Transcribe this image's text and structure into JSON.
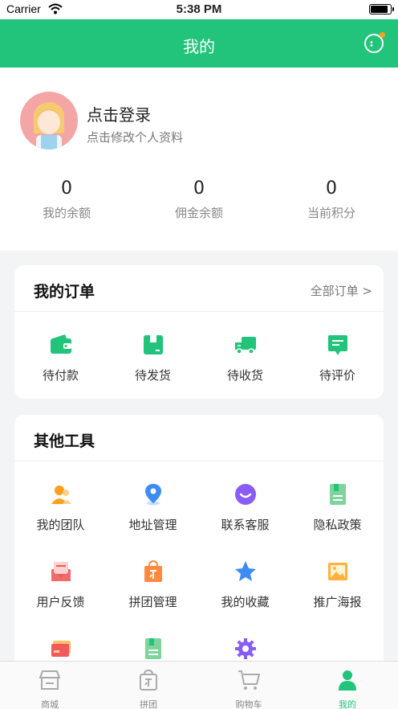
{
  "status_bar": {
    "carrier": "Carrier",
    "time": "5:38 PM",
    "battery_level": 0.9
  },
  "nav": {
    "title": "我的",
    "message_icon": "chat-icon"
  },
  "profile": {
    "login_text": "点击登录",
    "edit_text": "点击修改个人资料",
    "stats": [
      {
        "value": "0",
        "label": "我的余额"
      },
      {
        "value": "0",
        "label": "佣金余额"
      },
      {
        "value": "0",
        "label": "当前积分"
      }
    ]
  },
  "orders": {
    "title": "我的订单",
    "all_link": "全部订单 >",
    "items": [
      {
        "label": "待付款",
        "icon": "wallet-icon"
      },
      {
        "label": "待发货",
        "icon": "box-icon"
      },
      {
        "label": "待收货",
        "icon": "truck-icon"
      },
      {
        "label": "待评价",
        "icon": "comment-icon"
      }
    ]
  },
  "tools": {
    "title": "其他工具",
    "items": [
      {
        "label": "我的团队",
        "icon": "team-icon"
      },
      {
        "label": "地址管理",
        "icon": "location-icon"
      },
      {
        "label": "联系客服",
        "icon": "service-icon"
      },
      {
        "label": "隐私政策",
        "icon": "privacy-icon"
      },
      {
        "label": "用户反馈",
        "icon": "feedback-icon"
      },
      {
        "label": "拼团管理",
        "icon": "group-bag-icon"
      },
      {
        "label": "我的收藏",
        "icon": "star-icon"
      },
      {
        "label": "推广海报",
        "icon": "poster-icon"
      },
      {
        "label": "",
        "icon": "card-icon"
      },
      {
        "label": "",
        "icon": "document-icon"
      },
      {
        "label": "",
        "icon": "settings-icon"
      }
    ]
  },
  "tabbar": {
    "items": [
      {
        "label": "商城",
        "icon": "store-icon"
      },
      {
        "label": "拼团",
        "icon": "group-icon"
      },
      {
        "label": "购物车",
        "icon": "cart-icon"
      },
      {
        "label": "我的",
        "icon": "user-icon",
        "active": true
      }
    ]
  },
  "colors": {
    "primary": "#21c47a",
    "orange": "#ff9f1c",
    "blue": "#3d8bf5",
    "purple": "#8a5cf6",
    "red": "#f05a5a"
  }
}
